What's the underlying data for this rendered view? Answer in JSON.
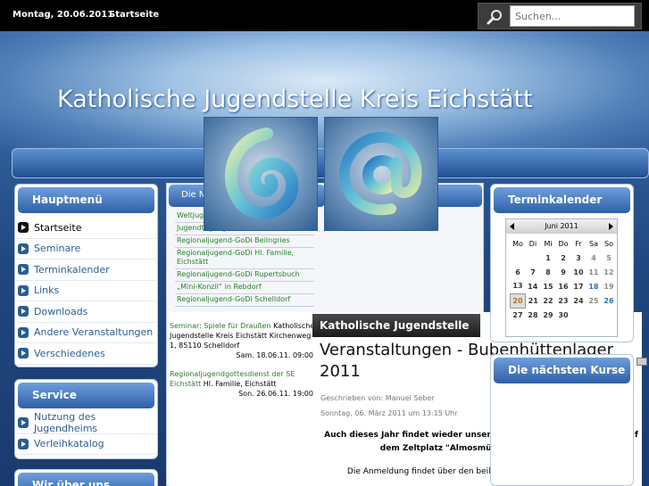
{
  "topbar": {
    "date": "Montag, 20.06.2011",
    "home": "Startseite",
    "search_placeholder": "Suchen..."
  },
  "site_title": "Katholische Jugendstelle Kreis Eichstätt",
  "hauptmenu": {
    "title": "Hauptmenü",
    "items": [
      "Startseite",
      "Seminare",
      "Terminkalender",
      "Links",
      "Downloads",
      "Andere Veranstaltungen",
      "Verschiedenes"
    ]
  },
  "service": {
    "title": "Service",
    "items": [
      "Nutzung des Jugendheims",
      "Verleihkatalog"
    ]
  },
  "wir": {
    "title": "Wir über uns"
  },
  "newest": {
    "title": "Die Neuesten Beiträge",
    "items": [
      "Weltjugendtag in Madrid",
      "Jugendtagung in Eichstätt",
      "Regionaljugend-GoDi Beilngries",
      "Regionaljugend-GoDi Hl. Familie, Eichstätt",
      "Regionaljugend-GoDi Rupertsbuch",
      "„Mini-Konzil“ in Rebdorf",
      "Regionaljugend-GoDi Schelldorf"
    ]
  },
  "events": [
    {
      "link": "Seminar: Spiele für Draußen",
      "place": "Katholische Jugendstelle Kreis Eichstätt Kirchenweg 1, 85110 Schelldorf",
      "date": "Sam. 18.06.11. 09:00"
    },
    {
      "link": "Regionaljugendgottesdienst der SE Eichstätt",
      "place": "Hl. Familie, Eichstätt",
      "date": "Son. 26.06.11. 19:00"
    }
  ],
  "article": {
    "tab": "Katholische Jugendstelle",
    "title": "Veranstaltungen - Bubenhüttenlager 2011",
    "author": "Geschrieben von: Manuel Seber",
    "date": "Sonntag, 06. März 2011 um 13:15 Uhr",
    "p1": "Auch dieses Jahr findet wieder unser beliebtes Bubenhüttenlager auf dem Zeltplatz \"Almosmühle\" bei Pfünz statt.",
    "p2": "Die Anmeldung findet über den beiliegenden Anmeldebogen statt."
  },
  "calendar": {
    "title": "Terminkalender",
    "month": "Juni 2011",
    "weekdays": [
      "Mo",
      "Di",
      "Mi",
      "Do",
      "Fr",
      "Sa",
      "So"
    ],
    "weeks": [
      [
        "",
        "",
        "1",
        "2",
        "3",
        "4",
        "5"
      ],
      [
        "6",
        "7",
        "8",
        "9",
        "10",
        "11",
        "12"
      ],
      [
        "13",
        "14",
        "15",
        "16",
        "17",
        "18",
        "19"
      ],
      [
        "20",
        "21",
        "22",
        "23",
        "24",
        "25",
        "26"
      ],
      [
        "27",
        "28",
        "29",
        "30",
        "",
        "",
        ""
      ]
    ],
    "today": "20",
    "highlighted": [
      "18",
      "26"
    ]
  },
  "courses": {
    "title": "Die nächsten Kurse"
  },
  "colors": {
    "accent": "#2e5fa6",
    "link_green": "#2b7d2b",
    "topbar": "#000000"
  }
}
